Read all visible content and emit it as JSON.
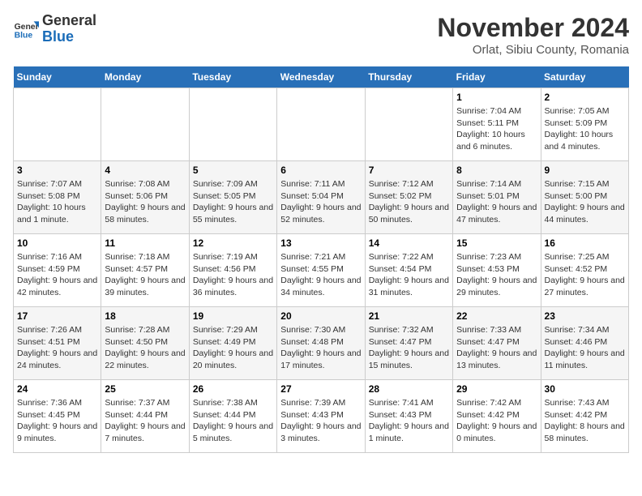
{
  "header": {
    "logo_general": "General",
    "logo_blue": "Blue",
    "month_year": "November 2024",
    "location": "Orlat, Sibiu County, Romania"
  },
  "weekdays": [
    "Sunday",
    "Monday",
    "Tuesday",
    "Wednesday",
    "Thursday",
    "Friday",
    "Saturday"
  ],
  "weeks": [
    [
      {
        "day": "",
        "info": ""
      },
      {
        "day": "",
        "info": ""
      },
      {
        "day": "",
        "info": ""
      },
      {
        "day": "",
        "info": ""
      },
      {
        "day": "",
        "info": ""
      },
      {
        "day": "1",
        "info": "Sunrise: 7:04 AM\nSunset: 5:11 PM\nDaylight: 10 hours and 6 minutes."
      },
      {
        "day": "2",
        "info": "Sunrise: 7:05 AM\nSunset: 5:09 PM\nDaylight: 10 hours and 4 minutes."
      }
    ],
    [
      {
        "day": "3",
        "info": "Sunrise: 7:07 AM\nSunset: 5:08 PM\nDaylight: 10 hours and 1 minute."
      },
      {
        "day": "4",
        "info": "Sunrise: 7:08 AM\nSunset: 5:06 PM\nDaylight: 9 hours and 58 minutes."
      },
      {
        "day": "5",
        "info": "Sunrise: 7:09 AM\nSunset: 5:05 PM\nDaylight: 9 hours and 55 minutes."
      },
      {
        "day": "6",
        "info": "Sunrise: 7:11 AM\nSunset: 5:04 PM\nDaylight: 9 hours and 52 minutes."
      },
      {
        "day": "7",
        "info": "Sunrise: 7:12 AM\nSunset: 5:02 PM\nDaylight: 9 hours and 50 minutes."
      },
      {
        "day": "8",
        "info": "Sunrise: 7:14 AM\nSunset: 5:01 PM\nDaylight: 9 hours and 47 minutes."
      },
      {
        "day": "9",
        "info": "Sunrise: 7:15 AM\nSunset: 5:00 PM\nDaylight: 9 hours and 44 minutes."
      }
    ],
    [
      {
        "day": "10",
        "info": "Sunrise: 7:16 AM\nSunset: 4:59 PM\nDaylight: 9 hours and 42 minutes."
      },
      {
        "day": "11",
        "info": "Sunrise: 7:18 AM\nSunset: 4:57 PM\nDaylight: 9 hours and 39 minutes."
      },
      {
        "day": "12",
        "info": "Sunrise: 7:19 AM\nSunset: 4:56 PM\nDaylight: 9 hours and 36 minutes."
      },
      {
        "day": "13",
        "info": "Sunrise: 7:21 AM\nSunset: 4:55 PM\nDaylight: 9 hours and 34 minutes."
      },
      {
        "day": "14",
        "info": "Sunrise: 7:22 AM\nSunset: 4:54 PM\nDaylight: 9 hours and 31 minutes."
      },
      {
        "day": "15",
        "info": "Sunrise: 7:23 AM\nSunset: 4:53 PM\nDaylight: 9 hours and 29 minutes."
      },
      {
        "day": "16",
        "info": "Sunrise: 7:25 AM\nSunset: 4:52 PM\nDaylight: 9 hours and 27 minutes."
      }
    ],
    [
      {
        "day": "17",
        "info": "Sunrise: 7:26 AM\nSunset: 4:51 PM\nDaylight: 9 hours and 24 minutes."
      },
      {
        "day": "18",
        "info": "Sunrise: 7:28 AM\nSunset: 4:50 PM\nDaylight: 9 hours and 22 minutes."
      },
      {
        "day": "19",
        "info": "Sunrise: 7:29 AM\nSunset: 4:49 PM\nDaylight: 9 hours and 20 minutes."
      },
      {
        "day": "20",
        "info": "Sunrise: 7:30 AM\nSunset: 4:48 PM\nDaylight: 9 hours and 17 minutes."
      },
      {
        "day": "21",
        "info": "Sunrise: 7:32 AM\nSunset: 4:47 PM\nDaylight: 9 hours and 15 minutes."
      },
      {
        "day": "22",
        "info": "Sunrise: 7:33 AM\nSunset: 4:47 PM\nDaylight: 9 hours and 13 minutes."
      },
      {
        "day": "23",
        "info": "Sunrise: 7:34 AM\nSunset: 4:46 PM\nDaylight: 9 hours and 11 minutes."
      }
    ],
    [
      {
        "day": "24",
        "info": "Sunrise: 7:36 AM\nSunset: 4:45 PM\nDaylight: 9 hours and 9 minutes."
      },
      {
        "day": "25",
        "info": "Sunrise: 7:37 AM\nSunset: 4:44 PM\nDaylight: 9 hours and 7 minutes."
      },
      {
        "day": "26",
        "info": "Sunrise: 7:38 AM\nSunset: 4:44 PM\nDaylight: 9 hours and 5 minutes."
      },
      {
        "day": "27",
        "info": "Sunrise: 7:39 AM\nSunset: 4:43 PM\nDaylight: 9 hours and 3 minutes."
      },
      {
        "day": "28",
        "info": "Sunrise: 7:41 AM\nSunset: 4:43 PM\nDaylight: 9 hours and 1 minute."
      },
      {
        "day": "29",
        "info": "Sunrise: 7:42 AM\nSunset: 4:42 PM\nDaylight: 9 hours and 0 minutes."
      },
      {
        "day": "30",
        "info": "Sunrise: 7:43 AM\nSunset: 4:42 PM\nDaylight: 8 hours and 58 minutes."
      }
    ]
  ]
}
